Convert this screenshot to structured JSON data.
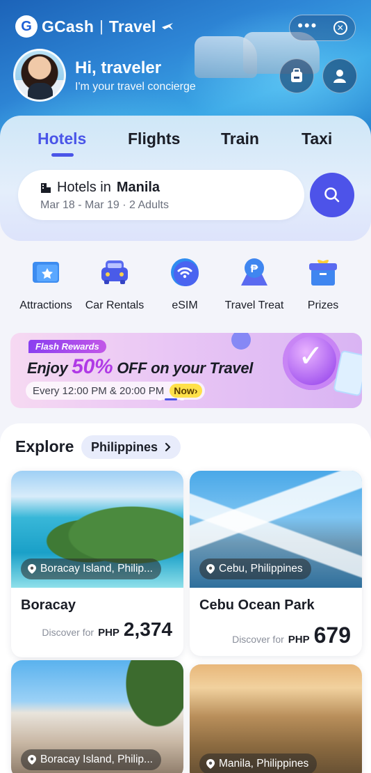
{
  "header": {
    "brand": "GCash",
    "brand_sub": "Travel",
    "logo_letter": "G",
    "greeting_title": "Hi, traveler",
    "greeting_sub": "I'm your travel concierge"
  },
  "tabs": [
    {
      "label": "Hotels",
      "active": true
    },
    {
      "label": "Flights",
      "active": false
    },
    {
      "label": "Train",
      "active": false
    },
    {
      "label": "Taxi",
      "active": false
    }
  ],
  "search": {
    "prefix": "Hotels in",
    "city": "Manila",
    "details": "Mar 18 - Mar 19 · 2 Adults"
  },
  "quick_actions": [
    {
      "label": "Attractions",
      "icon": "attractions-icon"
    },
    {
      "label": "Car Rentals",
      "icon": "car-icon"
    },
    {
      "label": "eSIM",
      "icon": "esim-icon"
    },
    {
      "label": "Travel Treat",
      "icon": "travel-treat-icon"
    },
    {
      "label": "Prizes",
      "icon": "prizes-icon"
    }
  ],
  "banner": {
    "tag": "Flash Rewards",
    "title_pre": "Enjoy",
    "title_pct": "50%",
    "title_post": "OFF on your Travel",
    "time": "Every 12:00 PM & 20:00 PM",
    "cta": "Now"
  },
  "explore": {
    "title": "Explore",
    "chip": "Philippines",
    "cards": [
      {
        "location": "Boracay Island, Philip...",
        "name": "Boracay",
        "discover": "Discover for",
        "currency": "PHP",
        "price": "2,374"
      },
      {
        "location": "Cebu, Philippines",
        "name": "Cebu Ocean Park",
        "discover": "Discover for",
        "currency": "PHP",
        "price": "679"
      },
      {
        "location": "Boracay Island, Philip...",
        "name": "",
        "discover": "",
        "currency": "",
        "price": ""
      },
      {
        "location": "Manila, Philippines",
        "name": "",
        "discover": "",
        "currency": "",
        "price": ""
      }
    ]
  },
  "colors": {
    "accent": "#4a55e8",
    "search_button": "#4d53e9",
    "promo": "#b03ae6"
  }
}
